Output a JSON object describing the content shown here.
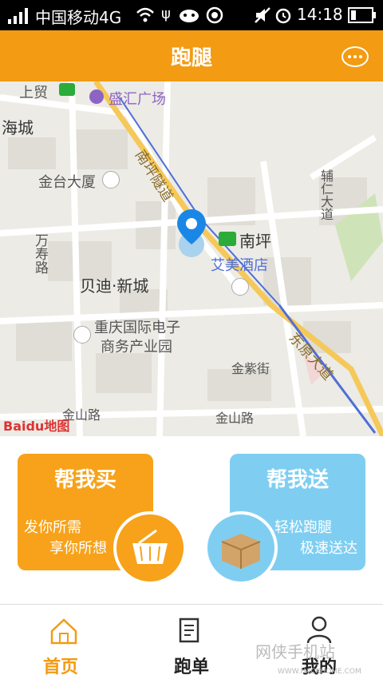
{
  "status": {
    "carrier": "中国移动4G",
    "time": "14:18"
  },
  "header": {
    "title": "跑腿"
  },
  "map": {
    "labels": [
      "上贸",
      "盛汇广场",
      "海城",
      "金台大厦",
      "南坪隧道",
      "万寿路",
      "贝迪·新城",
      "南坪",
      "艾美酒店",
      "重庆国际电子",
      "商务产业园",
      "辅仁大道",
      "东原大道",
      "金紫街",
      "金山路",
      "金山路"
    ],
    "brand": "Baidu地图"
  },
  "cards": {
    "buy": {
      "title": "帮我买",
      "line1": "发你所需",
      "line2": "享你所想"
    },
    "send": {
      "title": "帮我送",
      "line1": "轻松跑腿",
      "line2": "极速送达"
    }
  },
  "tabs": [
    {
      "label": "首页"
    },
    {
      "label": "跑单"
    },
    {
      "label": "我的"
    }
  ],
  "watermark": {
    "text": "网侠手机站",
    "url": "WWW.HACKHOME.COM"
  },
  "colors": {
    "accent": "#f39b12",
    "send": "#7fcef2"
  }
}
